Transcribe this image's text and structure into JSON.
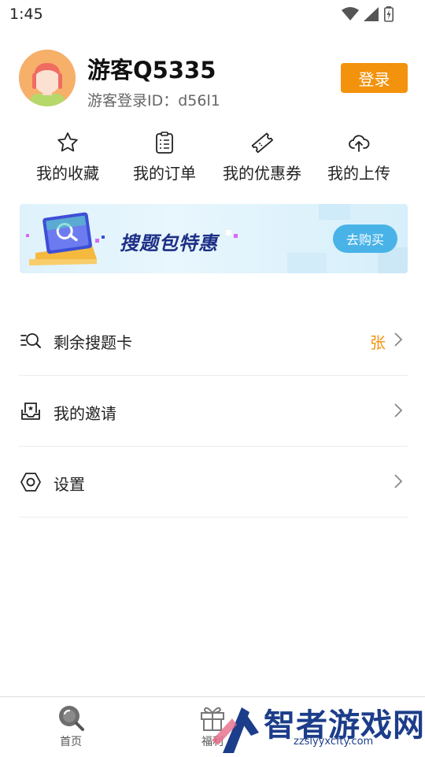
{
  "status_bar": {
    "time": "1:45"
  },
  "profile": {
    "name": "游客Q5335",
    "guest_id": "游客登录ID：d56l1",
    "login_label": "登录"
  },
  "quick_actions": [
    {
      "label": "我的收藏",
      "icon": "star-icon"
    },
    {
      "label": "我的订单",
      "icon": "clipboard-icon"
    },
    {
      "label": "我的优惠券",
      "icon": "coupon-icon"
    },
    {
      "label": "我的上传",
      "icon": "cloud-upload-icon"
    }
  ],
  "banner": {
    "title": "搜题包特惠",
    "button_label": "去购买"
  },
  "menu": [
    {
      "label": "剩余搜题卡",
      "value": "张",
      "icon": "search-list-icon"
    },
    {
      "label": "我的邀请",
      "value": "",
      "icon": "invite-inbox-icon"
    },
    {
      "label": "设置",
      "value": "",
      "icon": "settings-hexagon-icon"
    }
  ],
  "bottom_nav": [
    {
      "label": "首页",
      "icon": "search-icon"
    },
    {
      "label": "福利",
      "icon": "gift-icon"
    }
  ],
  "watermark": {
    "text": "智者游戏网",
    "url": "zzslyyxcfty.com"
  },
  "colors": {
    "accent": "#f3920c",
    "banner_button": "#49b3e8",
    "banner_title": "#1d2f86",
    "watermark": "#1c3d8a"
  }
}
